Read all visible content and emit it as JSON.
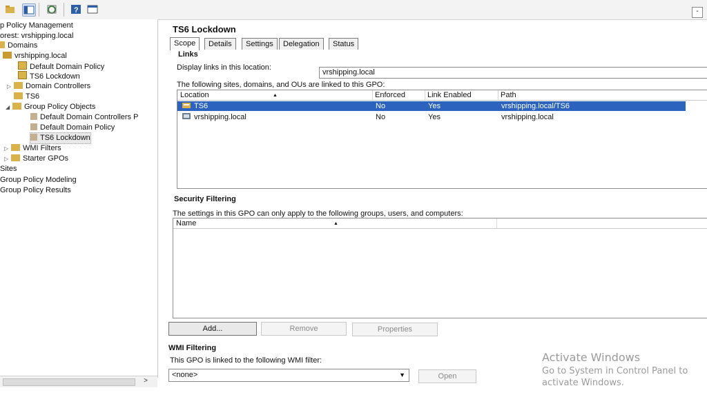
{
  "colors": {
    "selection": "#2b63bf",
    "folder": "#d9b24a",
    "toolbar_icon": "#2d5ea8"
  },
  "toolbar": {
    "icons": [
      "back-arrow-icon",
      "show-hide-tree-icon",
      "refresh-icon",
      "help-icon",
      "properties-icon"
    ],
    "close_label": "-"
  },
  "tree": {
    "items": [
      {
        "label": "p Policy Management",
        "icon": "gpm-icon"
      },
      {
        "label": "orest: vrshipping.local",
        "icon": "forest-icon"
      },
      {
        "label": "Domains",
        "icon": "domains-folder-icon"
      },
      {
        "label": "vrshipping.local",
        "icon": "domain-icon"
      },
      {
        "label": "Default Domain Policy",
        "icon": "gpo-link-icon"
      },
      {
        "label": "TS6 Lockdown",
        "icon": "gpo-link-icon"
      },
      {
        "label": "Domain Controllers",
        "icon": "ou-icon"
      },
      {
        "label": "TS6",
        "icon": "ou-icon"
      },
      {
        "label": "Group Policy Objects",
        "icon": "folder-icon"
      },
      {
        "label": "Default Domain Controllers P",
        "icon": "gpo-icon"
      },
      {
        "label": "Default Domain Policy",
        "icon": "gpo-icon"
      },
      {
        "label": "TS6 Lockdown",
        "icon": "gpo-icon"
      },
      {
        "label": "WMI Filters",
        "icon": "folder-icon"
      },
      {
        "label": "Starter GPOs",
        "icon": "folder-icon"
      },
      {
        "label": "Sites",
        "icon": ""
      },
      {
        "label": "Group Policy Modeling",
        "icon": ""
      },
      {
        "label": "Group Policy Results",
        "icon": ""
      }
    ]
  },
  "gpo": {
    "title": "TS6 Lockdown",
    "tabs": [
      "Scope",
      "Details",
      "Settings",
      "Delegation",
      "Status"
    ],
    "active_tab": "Scope"
  },
  "links": {
    "heading": "Links",
    "display_label": "Display links in this location:",
    "display_value": "vrshipping.local",
    "description": "The following sites, domains, and OUs are linked to this GPO:",
    "columns": [
      "Location",
      "Enforced",
      "Link Enabled",
      "Path"
    ],
    "rows": [
      {
        "location": "TS6",
        "enforced": "No",
        "link_enabled": "Yes",
        "path": "vrshipping.local/TS6",
        "selected": true
      },
      {
        "location": "vrshipping.local",
        "enforced": "No",
        "link_enabled": "Yes",
        "path": "vrshipping.local",
        "selected": false
      }
    ]
  },
  "security": {
    "heading": "Security Filtering",
    "description": "The settings in this GPO can only apply to the following groups, users, and computers:",
    "columns": [
      "Name"
    ],
    "buttons": {
      "add": "Add...",
      "remove": "Remove",
      "properties": "Properties"
    }
  },
  "wmi": {
    "heading": "WMI Filtering",
    "description": "This GPO is linked to the following WMI filter:",
    "selected": "<none>",
    "open_label": "Open"
  },
  "watermark": {
    "title": "Activate Windows",
    "subtitle": "Go to System in Control Panel to activate Windows."
  }
}
